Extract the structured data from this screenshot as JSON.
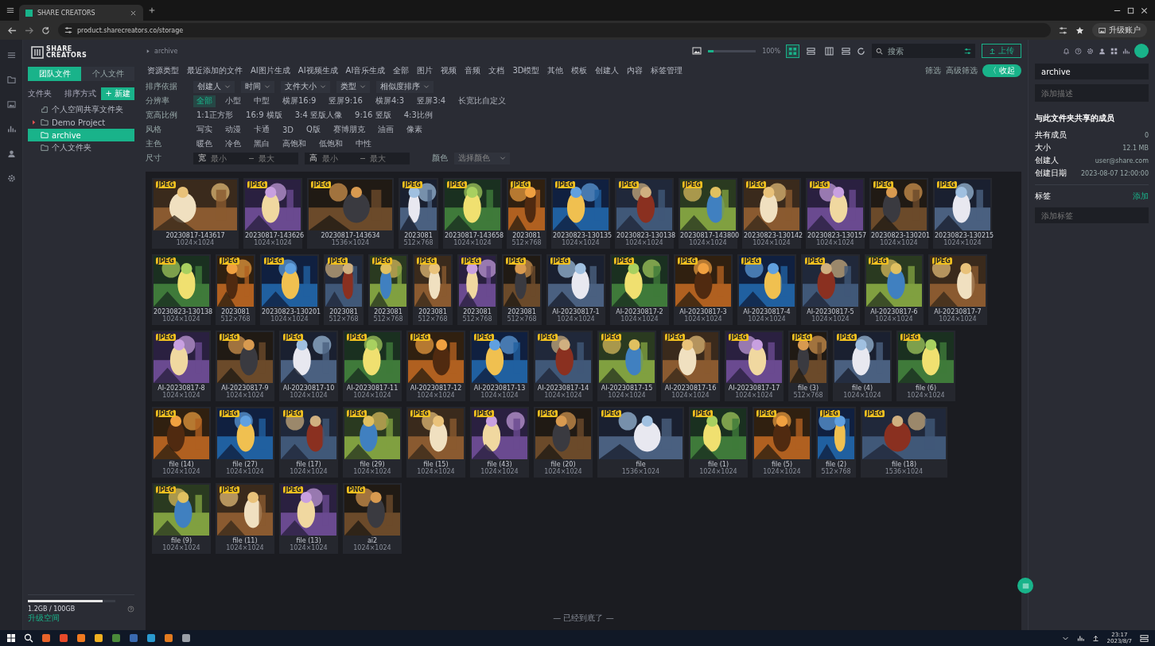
{
  "browser": {
    "tab_title": "SHARE CREATORS",
    "url": "product.sharecreators.co/storage",
    "profile_button": "升级账户"
  },
  "sidebar": {
    "logo_lines": [
      "SHARE",
      "CREATORS"
    ],
    "tabs": [
      {
        "label": "团队文件",
        "selected": true
      },
      {
        "label": "个人文件",
        "selected": false
      }
    ],
    "folder_label": "文件夹",
    "sort_button": "排序方式",
    "new_button": "+ 新建",
    "tree": [
      {
        "label": "个人空间共享文件夹",
        "selected": false,
        "has_children": false,
        "kind": "shared"
      },
      {
        "label": "Demo Project",
        "selected": false,
        "has_children": true,
        "kind": "folder"
      },
      {
        "label": "archive",
        "selected": true,
        "has_children": false,
        "kind": "folder"
      },
      {
        "label": "个人文件夹",
        "selected": false,
        "has_children": false,
        "kind": "folder"
      }
    ],
    "storage": {
      "text": "1.2GB / 100GB",
      "level": 0.85,
      "link": "升级空间"
    }
  },
  "toolbar": {
    "breadcrumb": "archive",
    "zoom": {
      "level": 0.12,
      "reading": "100%"
    },
    "view_modes": [
      {
        "selected": true
      },
      {
        "selected": false
      },
      {
        "selected": false
      }
    ],
    "search": {
      "placeholder": "搜索"
    },
    "upload_button": "上传"
  },
  "quick_filters": [
    "资源类型",
    "最近添加的文件",
    "AI图片生成",
    "AI视频生成",
    "AI音乐生成",
    "全部",
    "图片",
    "视频",
    "音频",
    "文档",
    "3D模型",
    "其他",
    "模板",
    "创建人",
    "内容",
    "标签管理"
  ],
  "filter_actions": [
    "筛选",
    "高级筛选"
  ],
  "collapse_button": "〈 收起",
  "filters": [
    {
      "label": "排序依据",
      "kind": "dropdowns",
      "options": [
        "创建人",
        "时间",
        "文件大小",
        "类型",
        "相似度排序"
      ]
    },
    {
      "label": "分辨率",
      "kind": "chips",
      "options": [
        {
          "label": "全部",
          "selected": true
        },
        {
          "label": "小型",
          "selected": false
        },
        {
          "label": "中型",
          "selected": false
        },
        {
          "label": "横屏16:9",
          "selected": false
        },
        {
          "label": "竖屏9:16",
          "selected": false
        },
        {
          "label": "横屏4:3",
          "selected": false
        },
        {
          "label": "竖屏3:4",
          "selected": false
        },
        {
          "label": "长宽比自定义",
          "selected": false
        }
      ]
    },
    {
      "label": "宽高比例",
      "kind": "chips",
      "options": [
        {
          "label": "1:1正方形",
          "selected": false
        },
        {
          "label": "16:9 横版",
          "selected": false
        },
        {
          "label": "3:4 竖版人像",
          "selected": false
        },
        {
          "label": "9:16 竖版",
          "selected": false
        },
        {
          "label": "4:3比例",
          "selected": false
        }
      ]
    },
    {
      "label": "风格",
      "kind": "chips",
      "options": [
        {
          "label": "写实",
          "selected": false
        },
        {
          "label": "动漫",
          "selected": false
        },
        {
          "label": "卡通",
          "selected": false
        },
        {
          "label": "3D",
          "selected": false
        },
        {
          "label": "Q版",
          "selected": false
        },
        {
          "label": "赛博朋克",
          "selected": false
        },
        {
          "label": "油画",
          "selected": false
        },
        {
          "label": "像素",
          "selected": false
        }
      ]
    },
    {
      "label": "主色",
      "kind": "chips",
      "options": [
        {
          "label": "暖色",
          "selected": false
        },
        {
          "label": "冷色",
          "selected": false
        },
        {
          "label": "黑白",
          "selected": false
        },
        {
          "label": "高饱和",
          "selected": false
        },
        {
          "label": "低饱和",
          "selected": false
        },
        {
          "label": "中性",
          "selected": false
        }
      ]
    },
    {
      "label": "尺寸",
      "kind": "range",
      "groups": [
        {
          "prefix": "宽",
          "fields": [
            {
              "placeholder": "最小"
            },
            {
              "placeholder": "最大"
            }
          ]
        },
        {
          "prefix": "高",
          "fields": [
            {
              "placeholder": "最小"
            },
            {
              "placeholder": "最大"
            }
          ]
        }
      ],
      "extra_label": "颜色",
      "extra_placeholder": "选择颜色"
    }
  ],
  "grid": {
    "rows": [
      {
        "items": [
          {
            "badge": "JPEG",
            "name": "20230817-143617",
            "info": "1024×1024",
            "kind": "wide"
          },
          {
            "badge": "JPEG",
            "name": "20230817-143626",
            "info": "1024×1024",
            "kind": "square"
          },
          {
            "badge": "JPEG",
            "name": "20230817-143634",
            "info": "1536×1024",
            "kind": "wide"
          },
          {
            "badge": "JPEG",
            "name": "2023081",
            "info": "512×768",
            "kind": "tall"
          },
          {
            "badge": "JPEG",
            "name": "20230817-143658",
            "info": "1024×1024",
            "kind": "square"
          },
          {
            "badge": "JPEG",
            "name": "2023081",
            "info": "512×768",
            "kind": "tall"
          },
          {
            "badge": "JPEG",
            "name": "20230823-130135",
            "info": "1024×1024",
            "kind": "square"
          },
          {
            "badge": "JPEG",
            "name": "20230823-130138",
            "info": "1024×1024",
            "kind": "square"
          },
          {
            "badge": "JPEG",
            "name": "20230817-143800",
            "info": "1024×1024",
            "kind": "square"
          },
          {
            "badge": "JPEG",
            "name": "20230823-130142",
            "info": "1024×1024",
            "kind": "square"
          },
          {
            "badge": "JPEG",
            "name": "20230823-130157",
            "info": "1024×1024",
            "kind": "square"
          },
          {
            "badge": "JPEG",
            "name": "20230823-130201",
            "info": "1024×1024",
            "kind": "square"
          },
          {
            "badge": "JPEG",
            "name": "20230823-130215",
            "info": "1024×1024",
            "kind": "square"
          }
        ]
      },
      {
        "items": [
          {
            "badge": "JPEG",
            "name": "20230823-130138",
            "info": "1024×1024",
            "kind": "square"
          },
          {
            "badge": "JPEG",
            "name": "2023081",
            "info": "512×768",
            "kind": "tall"
          },
          {
            "badge": "JPEG",
            "name": "20230823-130201",
            "info": "1024×1024",
            "kind": "square"
          },
          {
            "badge": "JPEG",
            "name": "2023081",
            "info": "512×768",
            "kind": "tall"
          },
          {
            "badge": "JPEG",
            "name": "2023081",
            "info": "512×768",
            "kind": "tall"
          },
          {
            "badge": "JPEG",
            "name": "2023081",
            "info": "512×768",
            "kind": "tall"
          },
          {
            "badge": "JPEG",
            "name": "2023081",
            "info": "512×768",
            "kind": "tall"
          },
          {
            "badge": "JPEG",
            "name": "2023081",
            "info": "512×768",
            "kind": "tall"
          },
          {
            "badge": "JPEG",
            "name": "AI-20230817-1",
            "info": "1024×1024",
            "kind": "square"
          },
          {
            "badge": "JPEG",
            "name": "AI-20230817-2",
            "info": "1024×1024",
            "kind": "square"
          },
          {
            "badge": "JPEG",
            "name": "AI-20230817-3",
            "info": "1024×1024",
            "kind": "square"
          },
          {
            "badge": "JPEG",
            "name": "AI-20230817-4",
            "info": "1024×1024",
            "kind": "square"
          },
          {
            "badge": "JPEG",
            "name": "AI-20230817-5",
            "info": "1024×1024",
            "kind": "square"
          },
          {
            "badge": "JPEG",
            "name": "AI-20230817-6",
            "info": "1024×1024",
            "kind": "square"
          },
          {
            "badge": "JPEG",
            "name": "AI-20230817-7",
            "info": "1024×1024",
            "kind": "square"
          }
        ]
      },
      {
        "items": [
          {
            "badge": "JPEG",
            "name": "AI-20230817-8",
            "info": "1024×1024",
            "kind": "square"
          },
          {
            "badge": "JPEG",
            "name": "AI-20230817-9",
            "info": "1024×1024",
            "kind": "square"
          },
          {
            "badge": "JPEG",
            "name": "AI-20230817-10",
            "info": "1024×1024",
            "kind": "square"
          },
          {
            "badge": "JPEG",
            "name": "AI-20230817-11",
            "info": "1024×1024",
            "kind": "square"
          },
          {
            "badge": "JPEG",
            "name": "AI-20230817-12",
            "info": "1024×1024",
            "kind": "square"
          },
          {
            "badge": "JPEG",
            "name": "AI-20230817-13",
            "info": "1024×1024",
            "kind": "square"
          },
          {
            "badge": "JPEG",
            "name": "AI-20230817-14",
            "info": "1024×1024",
            "kind": "square"
          },
          {
            "badge": "JPEG",
            "name": "AI-20230817-15",
            "info": "1024×1024",
            "kind": "square"
          },
          {
            "badge": "JPEG",
            "name": "AI-20230817-16",
            "info": "1024×1024",
            "kind": "square"
          },
          {
            "badge": "JPEG",
            "name": "AI-20230817-17",
            "info": "1024×1024",
            "kind": "square"
          },
          {
            "badge": "JPEG",
            "name": "file (3)",
            "info": "512×768",
            "kind": "tall"
          },
          {
            "badge": "JPEG",
            "name": "file (4)",
            "info": "1024×1024",
            "kind": "square"
          },
          {
            "badge": "JPEG",
            "name": "file (6)",
            "info": "1024×1024",
            "kind": "square"
          }
        ]
      },
      {
        "items": [
          {
            "badge": "JPEG",
            "name": "file (14)",
            "info": "1024×1024",
            "kind": "square"
          },
          {
            "badge": "JPEG",
            "name": "file (27)",
            "info": "1024×1024",
            "kind": "square"
          },
          {
            "badge": "JPEG",
            "name": "file (17)",
            "info": "1024×1024",
            "kind": "square"
          },
          {
            "badge": "JPEG",
            "name": "file (29)",
            "info": "1024×1024",
            "kind": "square"
          },
          {
            "badge": "JPEG",
            "name": "file (15)",
            "info": "1024×1024",
            "kind": "square"
          },
          {
            "badge": "JPEG",
            "name": "file (43)",
            "info": "1024×1024",
            "kind": "square"
          },
          {
            "badge": "JPEG",
            "name": "file (20)",
            "info": "1024×1024",
            "kind": "square"
          },
          {
            "badge": "JPEG",
            "name": "file",
            "info": "1536×1024",
            "kind": "wide"
          },
          {
            "badge": "JPEG",
            "name": "file (1)",
            "info": "1024×1024",
            "kind": "square"
          },
          {
            "badge": "JPEG",
            "name": "file (5)",
            "info": "1024×1024",
            "kind": "square"
          },
          {
            "badge": "JPEG",
            "name": "file (2)",
            "info": "512×768",
            "kind": "tall"
          },
          {
            "badge": "JPEG",
            "name": "file (18)",
            "info": "1536×1024",
            "kind": "wide"
          }
        ]
      },
      {
        "items": [
          {
            "badge": "JPEG",
            "name": "file (9)",
            "info": "1024×1024",
            "kind": "square"
          },
          {
            "badge": "JPEG",
            "name": "file (11)",
            "info": "1024×1024",
            "kind": "square"
          },
          {
            "badge": "JPEG",
            "name": "file (13)",
            "info": "1024×1024",
            "kind": "square"
          },
          {
            "badge": "PNG",
            "name": "ai2",
            "info": "1024×1024",
            "kind": "square"
          }
        ]
      }
    ],
    "end_text": "— 已经到底了 —"
  },
  "details": {
    "name_value": "archive",
    "description_placeholder": "添加描述",
    "section_title": "与此文件夹共享的成员",
    "rows": [
      {
        "label": "共有成员",
        "value": "0"
      },
      {
        "label": "大小",
        "value": "12.1 MB"
      },
      {
        "label": "创建人",
        "value": "user@share.com"
      },
      {
        "label": "创建日期",
        "value": "2023-08-07 12:00:00"
      }
    ],
    "tags_label": "标签",
    "tags_action": "添加",
    "tags_placeholder": "添加标签"
  },
  "taskbar": {
    "time": "23:17",
    "date": "2023/8/7"
  }
}
